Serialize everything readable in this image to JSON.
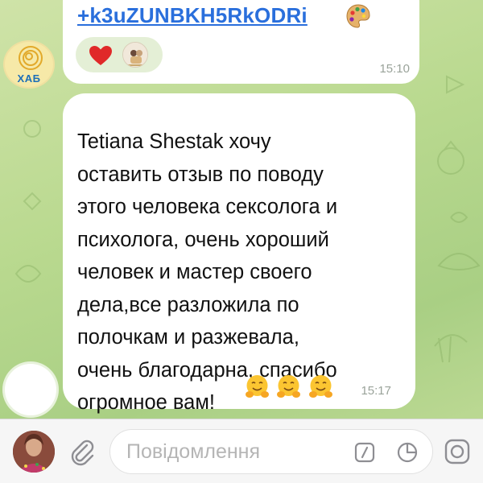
{
  "chat": {
    "previous_message": {
      "link_text": "+k3uZUNBKH5RkODRi",
      "palette_icon": "artist-palette-emoji",
      "reactions": [
        "red-heart",
        "reactor-avatar"
      ],
      "time": "15:10"
    },
    "sender_avatar_label": "ХАБ",
    "message": {
      "text": "Tetiana Shestak хочу\nоставить отзыв по поводу\nэтого человека сексолога и\nпсихолога, очень хороший\nчеловек и мастер своего\nдела,все разложила по\nполочкам и разжевала,\nочень благодарна, спасибо\nогромное вам!",
      "emoji": [
        "hugging-face",
        "hugging-face",
        "hugging-face"
      ],
      "time": "15:17"
    }
  },
  "input_bar": {
    "placeholder": "Повідомлення",
    "icons": [
      "attach-icon",
      "slash-command-icon",
      "sticker-icon",
      "camera-icon"
    ]
  },
  "colors": {
    "link": "#2a6fdc",
    "bubble": "#ffffff",
    "time": "#9aa39a",
    "background": "#b9d98f"
  }
}
